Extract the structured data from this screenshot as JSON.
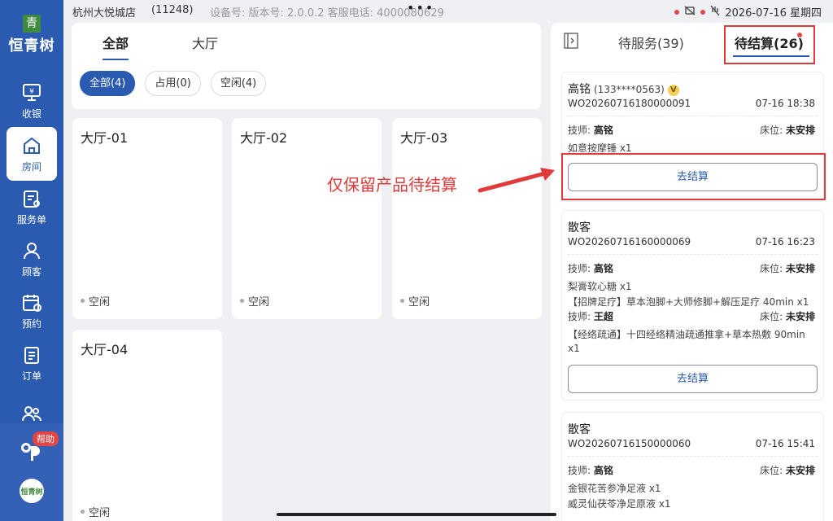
{
  "brand": {
    "mark": "青",
    "name": "恒青树"
  },
  "topbar": {
    "store": "杭州大悦城店",
    "store_code": "(11248)",
    "device": "设备号:  版本号:  2.0.0.2  客服电话:  4000080629",
    "datetime": "2026-07-16 星期四"
  },
  "nav": {
    "items": [
      {
        "label": "收银",
        "icon": "cashier-icon"
      },
      {
        "label": "房间",
        "icon": "home-icon",
        "active": true
      },
      {
        "label": "服务单",
        "icon": "service-order-icon"
      },
      {
        "label": "顾客",
        "icon": "customer-icon"
      },
      {
        "label": "预约",
        "icon": "calendar-icon"
      },
      {
        "label": "订单",
        "icon": "order-icon"
      },
      {
        "label": "",
        "icon": "team-icon"
      }
    ],
    "help_badge": "帮助",
    "avatar_text": "恒青树"
  },
  "filter": {
    "tabs": [
      "全部",
      "大厅"
    ],
    "chips": [
      "全部(4)",
      "占用(0)",
      "空闲(4)"
    ]
  },
  "rooms": [
    {
      "name": "大厅-01",
      "status": "空闲"
    },
    {
      "name": "大厅-02",
      "status": "空闲"
    },
    {
      "name": "大厅-03",
      "status": "空闲"
    },
    {
      "name": "大厅-04",
      "status": "空闲"
    }
  ],
  "right_panel": {
    "tab_service": "待服务(39)",
    "tab_settle": "待结算(26)"
  },
  "orders": [
    {
      "customer": "高铭",
      "phone": "(133****0563)",
      "vip": "V",
      "order_no": "WO20260716180000091",
      "time": "07-16 18:38",
      "tech_label": "技师:",
      "tech": "高铭",
      "bed_label": "床位:",
      "bed": "未安排",
      "item1": "如意按摩锤 x1",
      "button": "去结算"
    },
    {
      "customer": "散客",
      "order_no": "WO20260716160000069",
      "time": "07-16 16:23",
      "tech_label": "技师:",
      "tech": "高铭",
      "bed_label": "床位:",
      "bed": "未安排",
      "item1": "梨膏软心糖 x1",
      "item2": "【招牌足疗】草本泡脚+大师修脚+解压足疗 40min x1",
      "tech2_label": "技师:",
      "tech2": "王超",
      "bed2_label": "床位:",
      "bed2": "未安排",
      "item3": "【经络疏通】十四经络精油疏通推拿+草本热敷 90min",
      "item3b": "x1",
      "button": "去结算"
    },
    {
      "customer": "散客",
      "order_no": "WO20260716150000060",
      "time": "07-16 15:41",
      "tech_label": "技师:",
      "tech": "高铭",
      "bed_label": "床位:",
      "bed": "未安排",
      "item1": "金银花苦参净足液 x1",
      "item2": "威灵仙茯苓净足原液 x1"
    }
  ],
  "annotation": "仅保留产品待结算",
  "colors": {
    "primary": "#2b5bb0",
    "annotation": "#e23a3a"
  }
}
